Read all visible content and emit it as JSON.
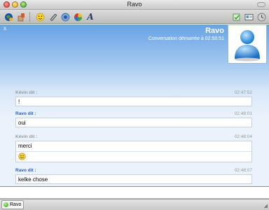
{
  "window": {
    "title": "Ravo"
  },
  "toolbar": {
    "left_icons": [
      "account-globe-icon",
      "profile-icon",
      "emoticon-icon",
      "attach-file-icon",
      "block-icon",
      "color-icon",
      "font-icon"
    ],
    "right_icons": [
      "send-file-icon",
      "info-card-icon",
      "history-icon"
    ]
  },
  "header": {
    "close_label": "x",
    "contact_name": "Ravo",
    "conversation_started": "Conversation démarrée à 02:50:51",
    "avatar_icon": "buddy-avatar-icon"
  },
  "messages": [
    {
      "sender": "Kévin dit :",
      "time": "02:47:52",
      "text": "!",
      "mine": false
    },
    {
      "sender": "Ravo dit :",
      "time": "02:48:01",
      "text": "oui",
      "mine": true
    },
    {
      "sender": "Kévin dit :",
      "time": "02:48:04",
      "text": "merci",
      "emoticon": "smiley-icon",
      "mine": false
    },
    {
      "sender": "Ravo dit :",
      "time": "02:48:07",
      "text": "kelke chose",
      "mine": true
    }
  ],
  "input": {
    "value": ""
  },
  "tabs": [
    {
      "label": "Ravo",
      "status": "online"
    }
  ],
  "colors": {
    "header_blue": "#66a3e6",
    "sender_me": "#2b5ec9",
    "sender_other": "#9a9a9a"
  }
}
